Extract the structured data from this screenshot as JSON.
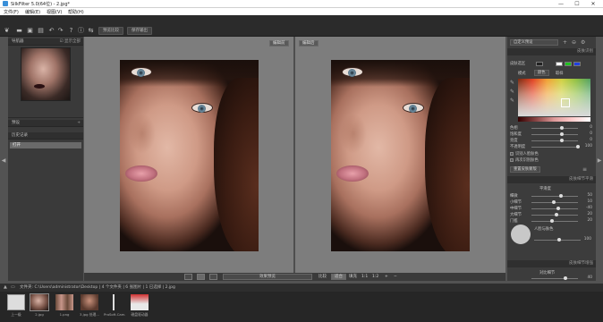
{
  "window": {
    "title": "SilkFilter 5.0(64位) - 2.jpg*",
    "minimize": "—",
    "maximize": "☐",
    "close": "✕"
  },
  "menu": [
    "文件(F)",
    "编辑(E)",
    "视图(V)",
    "帮助(H)"
  ],
  "toolbar": {
    "preview_btn": "预览比较",
    "export_btn": "保存输出"
  },
  "left_panel": {
    "navigator_title": "导航器",
    "navigator_option": "☑ 显示全部",
    "presets_title": "预设",
    "history_title": "历史记录",
    "history_items": [
      "打开"
    ]
  },
  "viewer": {
    "left_label": "编辑前",
    "right_label": "编辑后",
    "bottom": {
      "mode_btn": "效果预览",
      "compare_label": "比较",
      "fit_btn": "适合",
      "fill_label": "填充",
      "ratio_1": "1:1",
      "ratio_2": "1:2"
    }
  },
  "right_panel": {
    "preset_dropdown": "自定义预设",
    "skin_section": "皮肤识别",
    "skin_select_label": "皮肤选区",
    "mode_label": "模式",
    "mode_value": "颜色",
    "sample_label": "取样",
    "sliders": [
      {
        "label": "色相",
        "value": "0",
        "pos": 0.62
      },
      {
        "label": "饱和度",
        "value": "0",
        "pos": 0.62
      },
      {
        "label": "亮度",
        "value": "0",
        "pos": 0.62
      },
      {
        "label": "不透明度",
        "value": "100",
        "pos": 1.0
      }
    ],
    "check_1": "识别人脸肤色",
    "check_2": "再次识别肤色",
    "reset_btn": "重置皮肤蒙版",
    "skin_smooth_section": "皮肤细节平滑",
    "smooth_sub": "平滑度",
    "smooth_sliders": [
      {
        "label": "细微",
        "value": "50",
        "pos": 0.6
      },
      {
        "label": "小细节",
        "value": "10",
        "pos": 0.45
      },
      {
        "label": "中细节",
        "value": "-40",
        "pos": 0.55
      },
      {
        "label": "大细节",
        "value": "20",
        "pos": 0.5
      },
      {
        "label": "门槛",
        "value": "20",
        "pos": 0.4
      }
    ],
    "portrait_label": "人脸与肤色",
    "portrait_value": "100",
    "skin_contrast_section": "皮肤细节增强",
    "contrast_sub": "对比细节",
    "contrast_value": "40"
  },
  "pathbar": {
    "text": "文件夹: C:\\Users\\administrator\\Desktop  |  4 个文件夹  |  6 张图片  |  1 已选择  |  2.jpg"
  },
  "filmstrip": [
    {
      "caption": "上一级"
    },
    {
      "caption": "2.jpg"
    },
    {
      "caption": "1.png"
    },
    {
      "caption": "3.jpg 处理..."
    },
    {
      "caption": "ProSoft.Cam..."
    },
    {
      "caption": "磁盘驱动器"
    }
  ],
  "colors": {
    "accent": "#2f7fd1",
    "panel": "#3c3c3c",
    "viewer_bg": "#7d7d7d"
  }
}
